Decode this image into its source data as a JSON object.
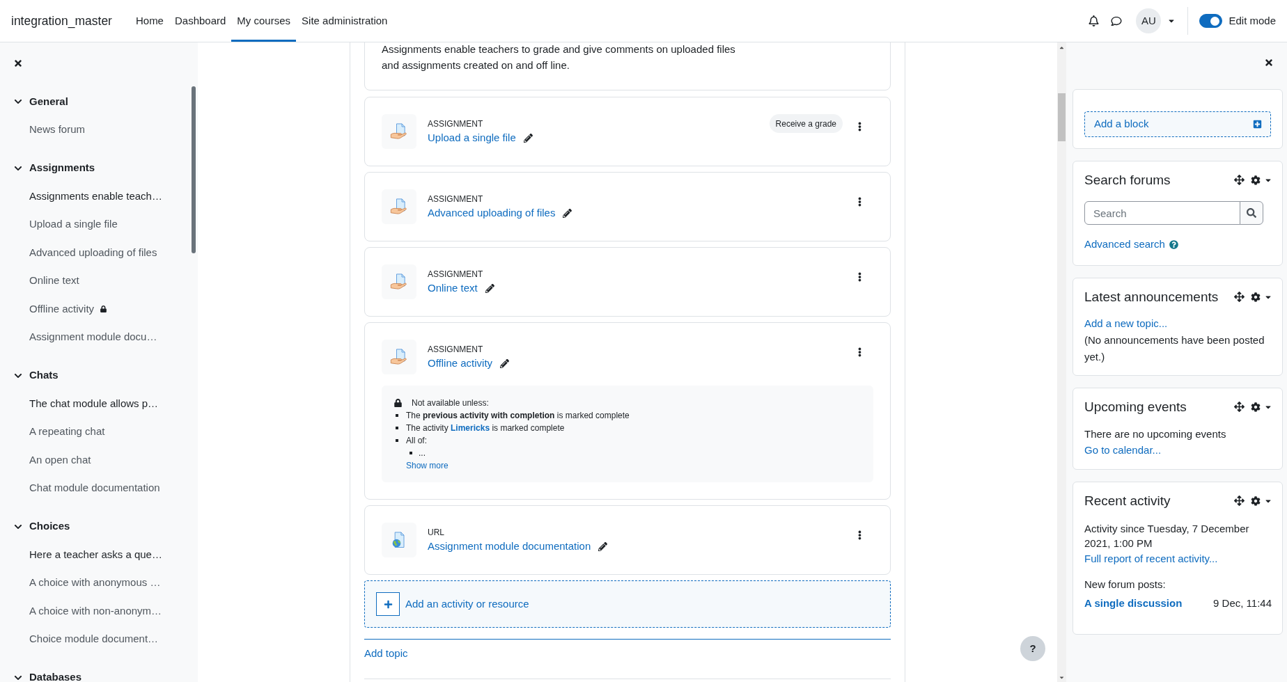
{
  "header": {
    "brand": "integration_master",
    "nav": [
      {
        "label": "Home",
        "selected": false
      },
      {
        "label": "Dashboard",
        "selected": false
      },
      {
        "label": "My courses",
        "selected": true
      },
      {
        "label": "Site administration",
        "selected": false
      }
    ],
    "avatar": "AU",
    "edit_mode": {
      "label": "Edit mode",
      "on": true
    }
  },
  "course_index": {
    "sections": [
      {
        "title": "General",
        "expanded": true,
        "items": [
          {
            "label": "News forum",
            "kind": "activity",
            "restricted": false
          }
        ]
      },
      {
        "title": "Assignments",
        "expanded": true,
        "items": [
          {
            "label": "Assignments enable teach…",
            "kind": "label",
            "restricted": false
          },
          {
            "label": "Upload a single file",
            "kind": "activity",
            "restricted": false
          },
          {
            "label": "Advanced uploading of files",
            "kind": "activity",
            "restricted": false
          },
          {
            "label": "Online text",
            "kind": "activity",
            "restricted": false
          },
          {
            "label": "Offline activity",
            "kind": "activity",
            "restricted": true
          },
          {
            "label": "Assignment module docu…",
            "kind": "activity",
            "restricted": false
          }
        ]
      },
      {
        "title": "Chats",
        "expanded": true,
        "items": [
          {
            "label": "The chat module allows p…",
            "kind": "label",
            "restricted": false
          },
          {
            "label": "A repeating chat",
            "kind": "activity",
            "restricted": false
          },
          {
            "label": "An open chat",
            "kind": "activity",
            "restricted": false
          },
          {
            "label": "Chat module documentation",
            "kind": "activity",
            "restricted": false
          }
        ]
      },
      {
        "title": "Choices",
        "expanded": true,
        "items": [
          {
            "label": "Here a teacher asks a que…",
            "kind": "label",
            "restricted": false
          },
          {
            "label": "A choice with anonymous …",
            "kind": "activity",
            "restricted": false
          },
          {
            "label": "A choice with non-anonym…",
            "kind": "activity",
            "restricted": false
          },
          {
            "label": "Choice module document…",
            "kind": "activity",
            "restricted": false
          }
        ]
      },
      {
        "title": "Databases",
        "expanded": true
      }
    ]
  },
  "activities": [
    {
      "kind": "label",
      "text": "Assignments enable teachers to grade and give comments on uploaded files and assignments created on and off line."
    },
    {
      "kind": "assignment",
      "type": "ASSIGNMENT",
      "name": "Upload a single file",
      "badge": "Receive a grade"
    },
    {
      "kind": "assignment",
      "type": "ASSIGNMENT",
      "name": "Advanced uploading of files"
    },
    {
      "kind": "assignment",
      "type": "ASSIGNMENT",
      "name": "Online text"
    },
    {
      "kind": "assignment",
      "type": "ASSIGNMENT",
      "name": "Offline activity",
      "availability": {
        "heading": "Not available unless:",
        "conditions": [
          {
            "parts": [
              {
                "kind": "text",
                "text": "The **previous activity with completion** is marked complete"
              }
            ]
          },
          {
            "parts": [
              {
                "kind": "text",
                "text": "The activity "
              },
              {
                "kind": "link",
                "text": "Limericks"
              },
              {
                "kind": "text",
                "text": " is marked complete"
              }
            ]
          },
          {
            "parts": [
              {
                "kind": "text",
                "text": "All of:"
              }
            ],
            "children": [
              {
                "parts": [
                  {
                    "kind": "text",
                    "text": "..."
                  }
                ]
              }
            ]
          }
        ],
        "more": "Show more"
      }
    },
    {
      "kind": "url",
      "type": "URL",
      "name": "Assignment module documentation"
    }
  ],
  "add_activity": "Add an activity or resource",
  "add_topic": "Add topic",
  "help": "?",
  "block_drawer": {
    "add_block": "Add a block",
    "blocks": [
      {
        "kind": "search_forums",
        "title": "Search forums",
        "search": {
          "placeholder": "Search"
        },
        "advanced_search": "Advanced search"
      },
      {
        "kind": "news",
        "title": "Latest announcements",
        "link": "Add a new topic...",
        "text": "(No announcements have been posted yet.)"
      },
      {
        "kind": "calendar",
        "title": "Upcoming events",
        "text": "There are no upcoming events",
        "link": "Go to calendar..."
      },
      {
        "kind": "recent_activity",
        "title": "Recent activity",
        "text": "Activity since Tuesday, 7 December 2021, 1:00 PM",
        "link": "Full report of recent activity...",
        "posts_heading": "New forum posts:",
        "posts": [
          {
            "title": "A single discussion",
            "date": "9 Dec, 11:44"
          }
        ]
      }
    ]
  }
}
